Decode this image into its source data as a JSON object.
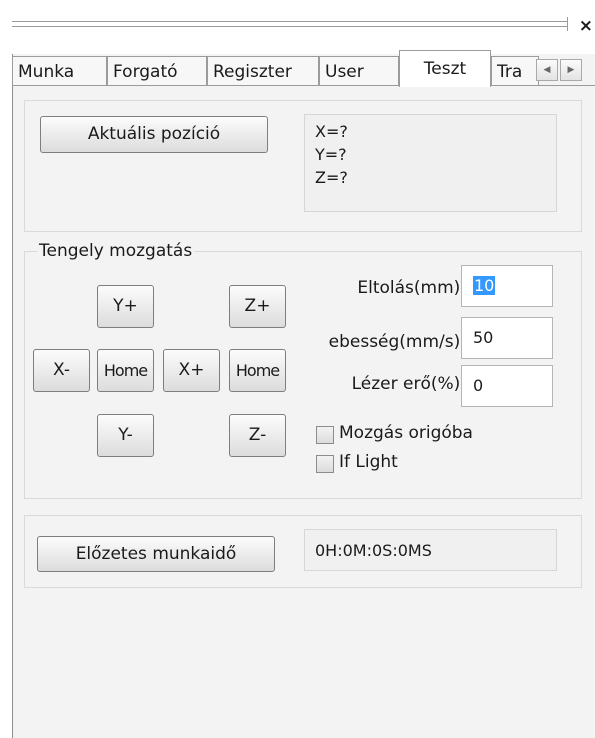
{
  "tabs": [
    "Munka",
    "Forgató",
    "Regiszter",
    "User",
    "Teszt",
    "Tra"
  ],
  "active_tab": "Teszt",
  "tab_scroll": {
    "left": "◀",
    "right": "▶"
  },
  "close_label": "×",
  "position": {
    "button_label": "Aktuális pozíció",
    "x": "X=?",
    "y": "Y=?",
    "z": "Z=?"
  },
  "axis": {
    "group_title": "Tengely mozgatás",
    "y_plus": "Y+",
    "y_minus": "Y-",
    "x_minus": "X-",
    "x_plus": "X+",
    "home_xy": "Home",
    "z_plus": "Z+",
    "z_minus": "Z-",
    "home_z": "Home",
    "offset_label": "Eltolás(mm):",
    "offset_value": "10",
    "speed_label": "ebesség(mm/s):",
    "speed_value": "50",
    "power_label": "Lézer erő(%):",
    "power_value": "0",
    "move_origin_label": "Mozgás origóba",
    "move_origin_checked": false,
    "if_light_label": "If Light",
    "if_light_checked": false
  },
  "estimate": {
    "button_label": "Előzetes munkaidő",
    "value": "0H:0M:0S:0MS"
  }
}
